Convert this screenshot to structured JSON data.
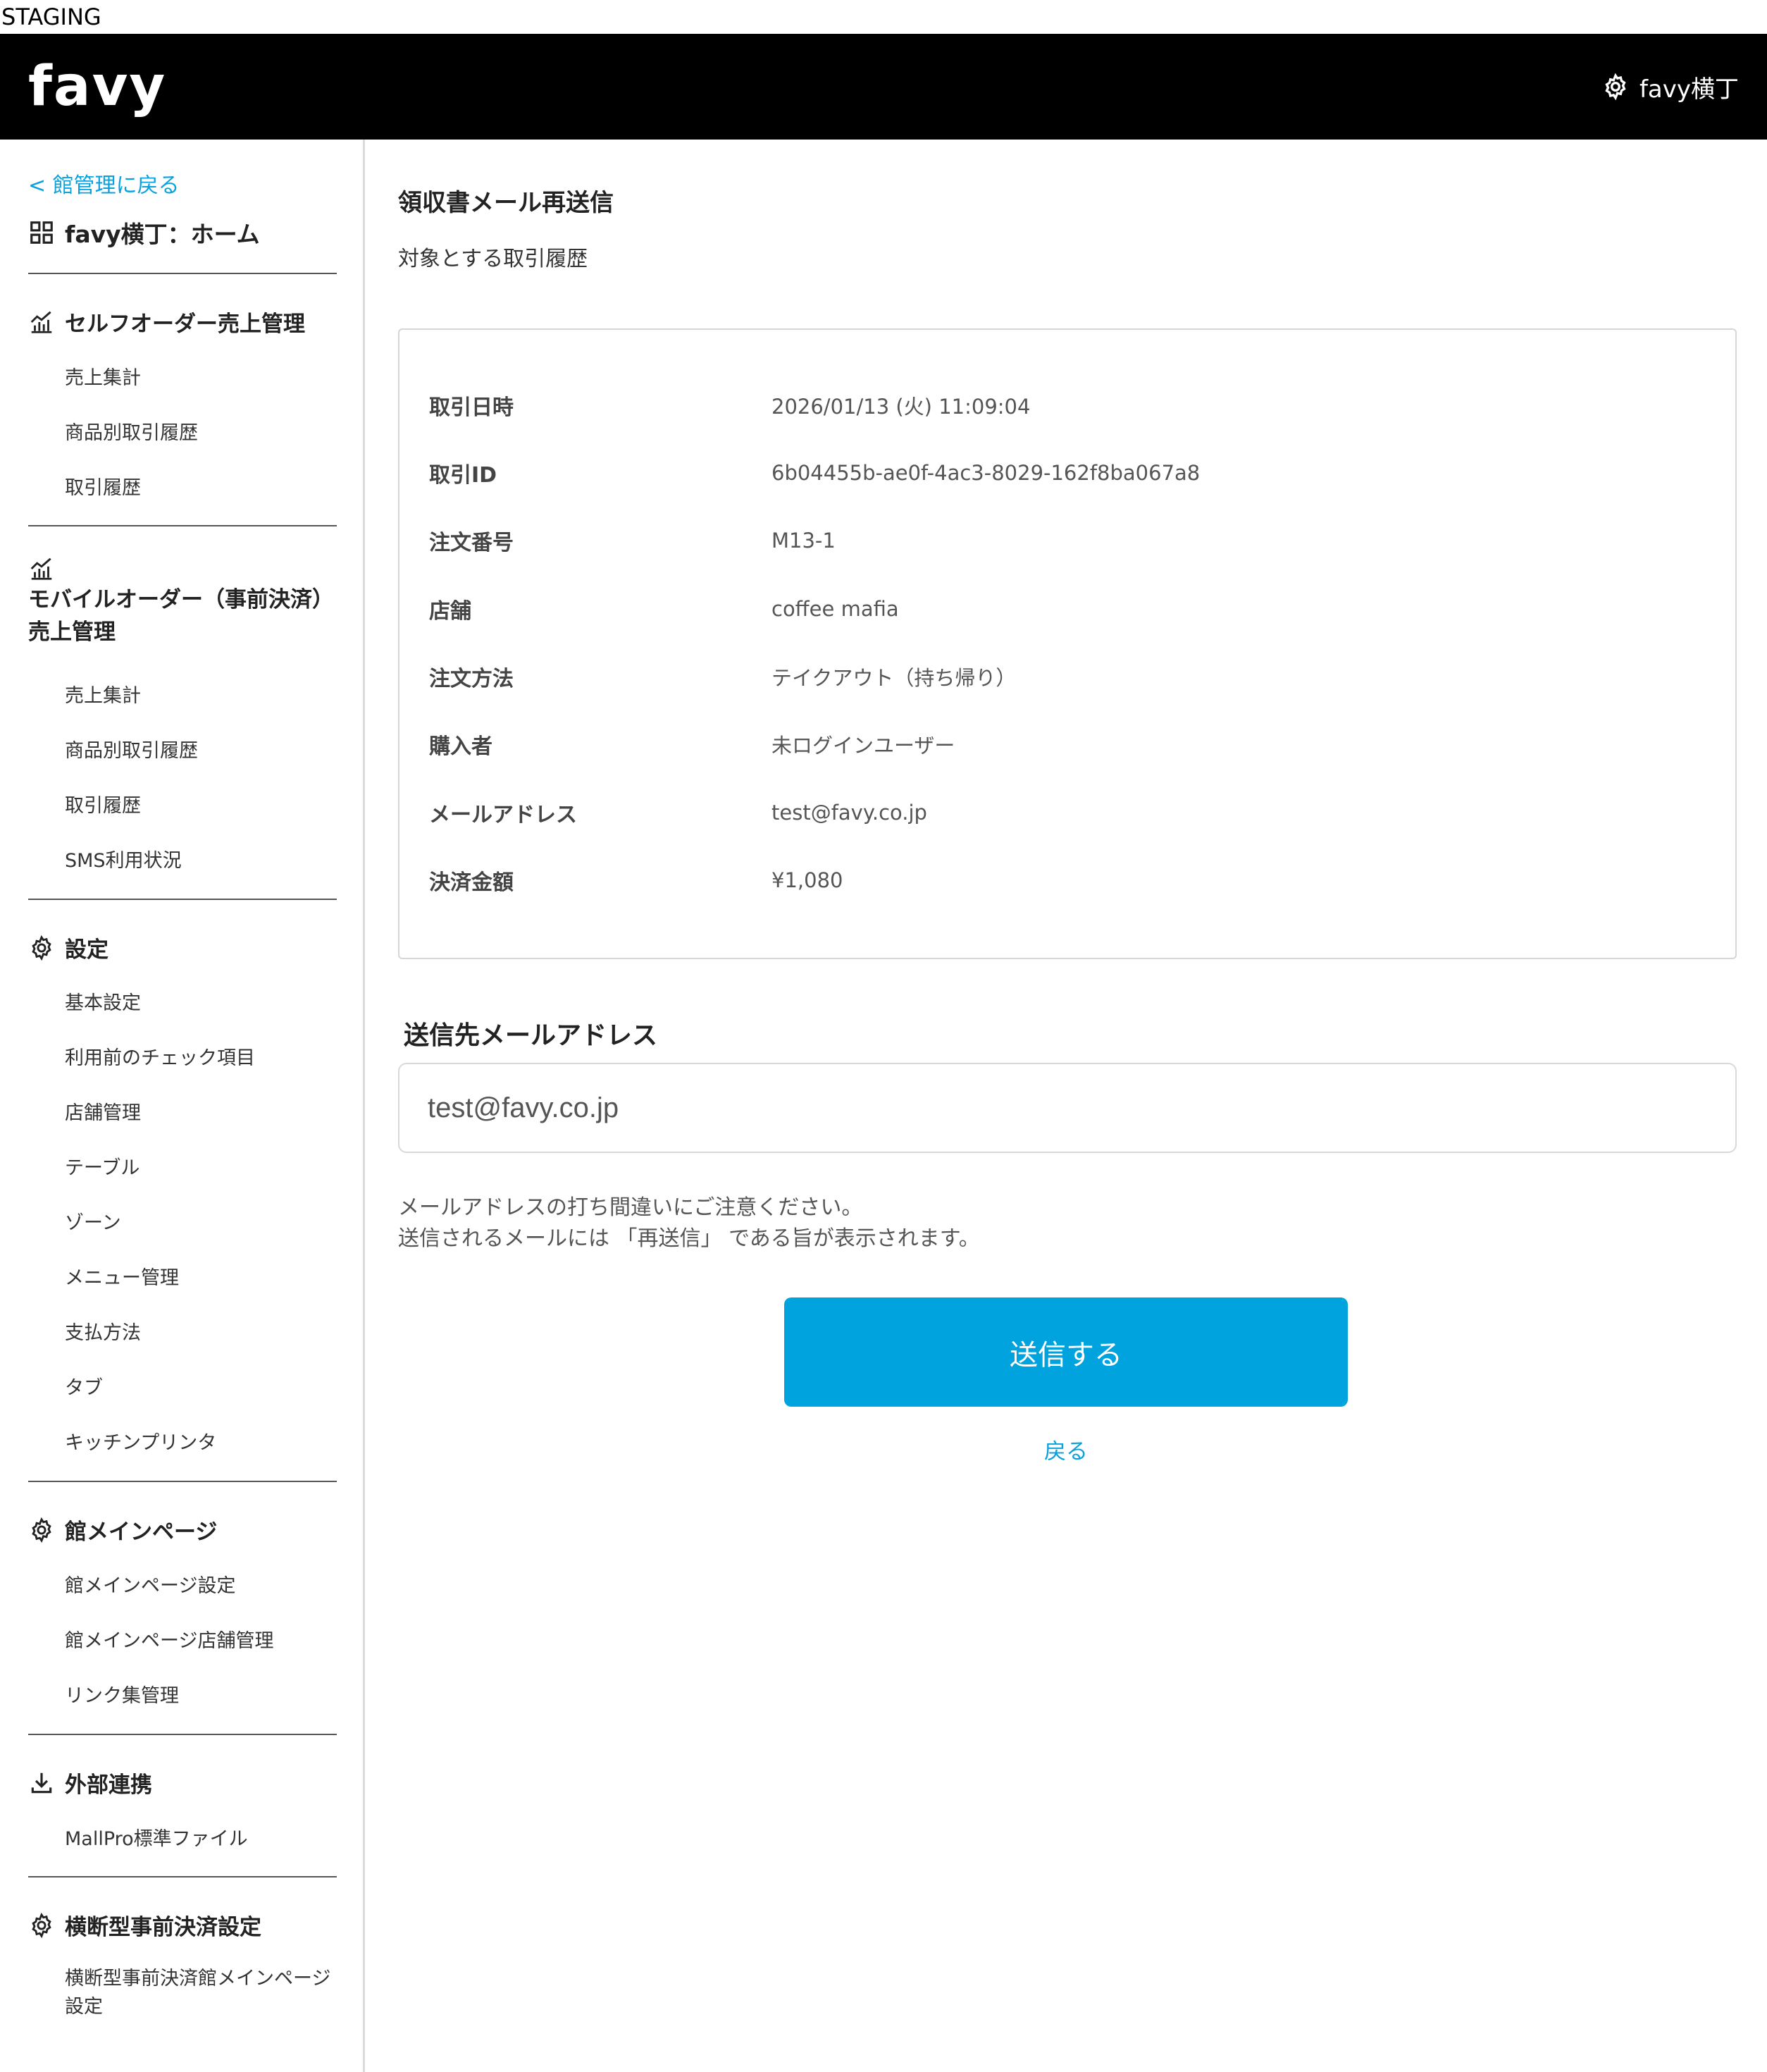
{
  "env_banner": "STAGING",
  "header": {
    "logo": "favy",
    "account_label": "favy横丁"
  },
  "sidebar": {
    "back_link": "< 館管理に戻る",
    "home_title": "favy横丁：ホーム",
    "sections": {
      "self_order": {
        "title": "セルフオーダー売上管理",
        "items": [
          "売上集計",
          "商品別取引履歴",
          "取引履歴"
        ]
      },
      "mobile_order": {
        "title_line1": "モバイルオーダー（事前決済）",
        "title_line2": "売上管理",
        "items": [
          "売上集計",
          "商品別取引履歴",
          "取引履歴",
          "SMS利用状況"
        ]
      },
      "settings": {
        "title": "設定",
        "items": [
          "基本設定",
          "利用前のチェック項目",
          "店舗管理",
          "テーブル",
          "ゾーン",
          "メニュー管理",
          "支払方法",
          "タブ",
          "キッチンプリンタ"
        ]
      },
      "main_page": {
        "title": "館メインページ",
        "items": [
          "館メインページ設定",
          "館メインページ店舗管理",
          "リンク集管理"
        ]
      },
      "external": {
        "title": "外部連携",
        "items": [
          "MallPro標準ファイル"
        ]
      },
      "cross_prepay": {
        "title": "横断型事前決済設定",
        "items": [
          "横断型事前決済館メインページ設定"
        ]
      }
    }
  },
  "main": {
    "title": "領収書メール再送信",
    "subtitle": "対象とする取引履歴",
    "details": [
      {
        "label": "取引日時",
        "value": "2026/01/13 (火) 11:09:04"
      },
      {
        "label": "取引ID",
        "value": "6b04455b-ae0f-4ac3-8029-162f8ba067a8"
      },
      {
        "label": "注文番号",
        "value": "M13-1"
      },
      {
        "label": "店舗",
        "value": "coffee mafia"
      },
      {
        "label": "注文方法",
        "value": "テイクアウト（持ち帰り）"
      },
      {
        "label": "購入者",
        "value": "未ログインユーザー"
      },
      {
        "label": "メールアドレス",
        "value": "test@favy.co.jp"
      },
      {
        "label": "決済金額",
        "value": "¥1,080"
      }
    ],
    "email_section_label": "送信先メールアドレス",
    "email_value": "test@favy.co.jp",
    "notice_line1": "メールアドレスの打ち間違いにご注意ください。",
    "notice_line2": "送信されるメールには 「再送信」 である旨が表示されます。",
    "submit_label": "送信する",
    "back_label": "戻る"
  },
  "colors": {
    "accent": "#00a3dd",
    "link": "#0aa1dc",
    "header_bg": "#000000"
  }
}
